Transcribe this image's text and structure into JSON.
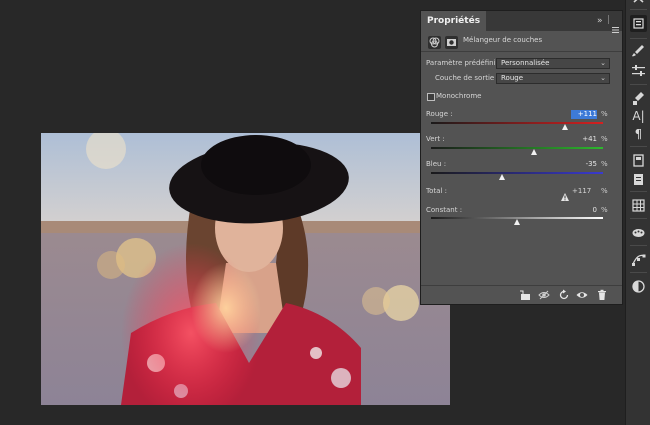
{
  "panel": {
    "tab_title": "Propriétés",
    "collapse_glyph": "»",
    "adjustment_name": "Mélangeur de couches",
    "preset_label": "Paramètre prédéfini :",
    "preset_value": "Personnalisée",
    "output_label": "Couche de sortie :",
    "output_value": "Rouge",
    "monochrome_label": "Monochrome",
    "monochrome_checked": false,
    "sliders": [
      {
        "label": "Rouge :",
        "value": "+111",
        "pct": "%",
        "fraction": 0.78
      },
      {
        "label": "Vert :",
        "value": "+41",
        "pct": "%",
        "fraction": 0.6
      },
      {
        "label": "Bleu :",
        "value": "-35",
        "pct": "%",
        "fraction": 0.41
      }
    ],
    "total_label": "Total :",
    "total_value": "+117",
    "total_pct": "%",
    "constant_label": "Constant :",
    "constant_value": "0",
    "constant_pct": "%",
    "constant_fraction": 0.5
  },
  "toolbar_icons": [
    "properties-panel-icon",
    "brushes-icon",
    "adjustments-sliders-icon",
    "brush-settings-icon",
    "character-icon",
    "paragraph-icon",
    "libraries-icon",
    "notes-icon",
    "swatches-grid-icon",
    "actions-icon",
    "paths-icon",
    "adjustments-icon"
  ],
  "colors": {
    "red_track": "#d62020",
    "green_track": "#2db82d",
    "blue_track": "#3a3ad0",
    "panel_bg": "#535353",
    "app_bg": "#282828"
  }
}
